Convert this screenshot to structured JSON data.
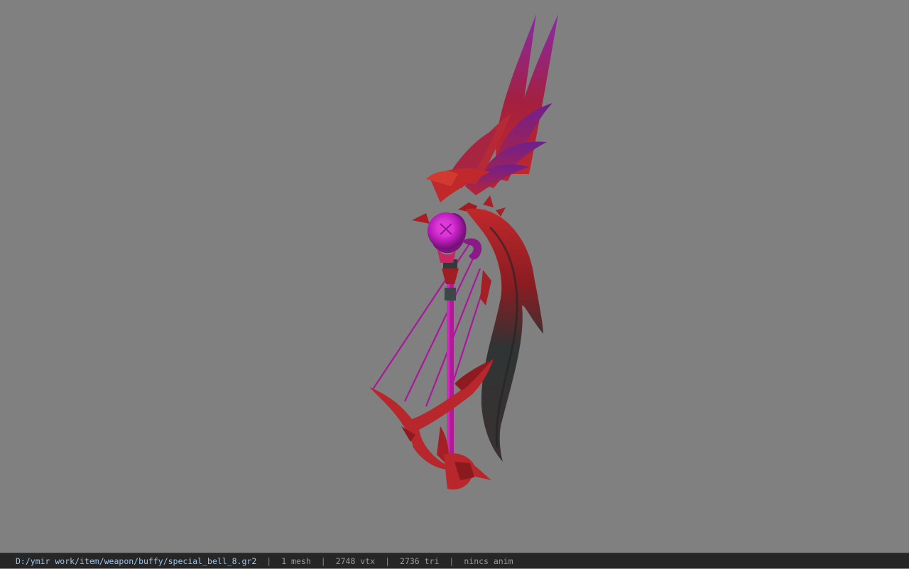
{
  "viewer": {
    "background_color": "#808080",
    "model": {
      "icon": "bow-weapon-model",
      "colors": {
        "primary_red": "#c0282b",
        "dark_red": "#7e1418",
        "magenta": "#b01aa8",
        "purple": "#7a1a8a",
        "gem": "#d61fd0",
        "blade_dark": "#2b2f30"
      }
    }
  },
  "status_bar": {
    "file_path": "D:/ymir work/item/weapon/buffy/special_bell_8.gr2",
    "separator": "|",
    "mesh": "1 mesh",
    "vtx": "2748 vtx",
    "tri": "2736 tri",
    "anim": "nincs anim"
  }
}
